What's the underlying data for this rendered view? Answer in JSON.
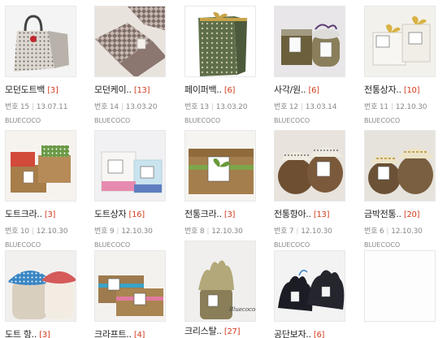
{
  "posts": [
    {
      "title": "모던도트백",
      "count": "[3]",
      "no_label": "번호",
      "no": "15",
      "date": "13.07.11",
      "author": "BLUECOCO",
      "image": "dotted-bag-photo"
    },
    {
      "title": "모던케이..",
      "count": "[13]",
      "no_label": "번호",
      "no": "14",
      "date": "13.03.20",
      "author": "BLUECOCO",
      "image": "pattern-cases-photo"
    },
    {
      "title": "페이퍼백..",
      "count": "[6]",
      "no_label": "번호",
      "no": "13",
      "date": "13.03.20",
      "author": "BLUECOCO",
      "image": "paper-bag-photo"
    },
    {
      "title": "사각/원..",
      "count": "[6]",
      "no_label": "번호",
      "no": "12",
      "date": "13.03.14",
      "author": "BLUECOCO",
      "image": "square-round-box-photo"
    },
    {
      "title": "전통상자..",
      "count": "[10]",
      "no_label": "번호",
      "no": "11",
      "date": "12.10.30",
      "author": "BLUECOCO",
      "image": "traditional-box-photo"
    },
    {
      "title": "도트크라..",
      "count": "[3]",
      "no_label": "번호",
      "no": "10",
      "date": "12.10.30",
      "author": "BLUECOCO",
      "image": "dot-kraft-box-photo"
    },
    {
      "title": "도트상자",
      "count": "[16]",
      "no_label": "번호",
      "no": "9",
      "date": "12.10.30",
      "author": "BLUECOCO",
      "image": "dot-box-photo"
    },
    {
      "title": "전통크라..",
      "count": "[3]",
      "no_label": "번호",
      "no": "8",
      "date": "12.10.30",
      "author": "BLUECOCO",
      "image": "traditional-kraft-photo"
    },
    {
      "title": "전통항아..",
      "count": "[13]",
      "no_label": "번호",
      "no": "7",
      "date": "12.10.30",
      "author": "BLUECOCO",
      "image": "traditional-jar-photo"
    },
    {
      "title": "금박전통..",
      "count": "[20]",
      "no_label": "번호",
      "no": "6",
      "date": "12.10.30",
      "author": "BLUECOCO",
      "image": "gold-foil-jar-photo"
    },
    {
      "title": "도트 항..",
      "count": "[3]",
      "no_label": "",
      "no": "",
      "date": "",
      "author": "",
      "image": "dot-jar-photo"
    },
    {
      "title": "크라프트..",
      "count": "[4]",
      "no_label": "",
      "no": "",
      "date": "",
      "author": "",
      "image": "kraft-box-photo"
    },
    {
      "title": "크리스탈..",
      "count": "[27]",
      "no_label": "",
      "no": "",
      "date": "",
      "author": "",
      "image": "crystal-wrap-photo",
      "caption": "Bluecoco"
    },
    {
      "title": "공단보자..",
      "count": "[6]",
      "no_label": "",
      "no": "",
      "date": "",
      "author": "",
      "image": "satin-wrap-photo"
    }
  ]
}
